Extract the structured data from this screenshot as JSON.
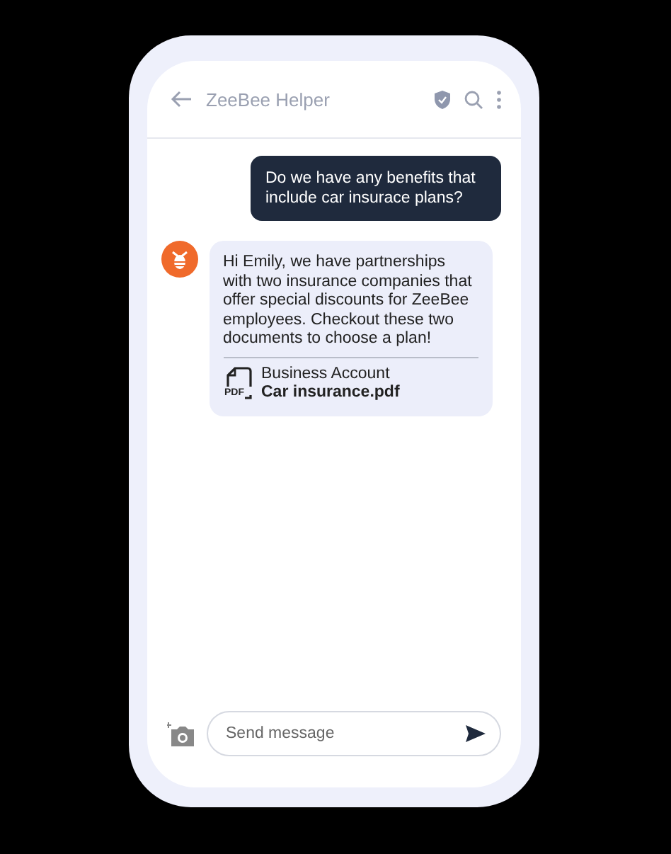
{
  "header": {
    "title": "ZeeBee Helper"
  },
  "messages": [
    {
      "kind": "outgoing",
      "text": "Do we have any benefits that include car insurace plans?"
    },
    {
      "kind": "incoming",
      "text": "Hi Emily, we have partnerships with two insurance companies that offer special discounts for ZeeBee employees. Checkout these two documents to choose a plan!",
      "attachment": {
        "badge": "PDF",
        "folder": "Business Account",
        "file": "Car insurance.pdf"
      }
    }
  ],
  "composer": {
    "placeholder": "Send message"
  }
}
